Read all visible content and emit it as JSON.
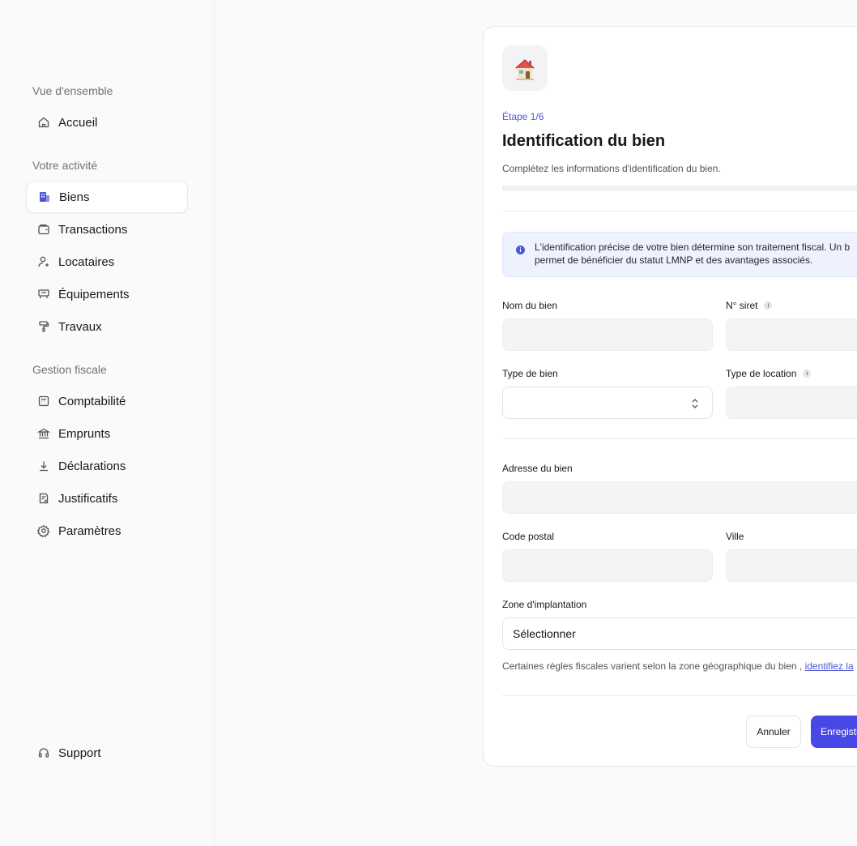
{
  "sidebar": {
    "sections": [
      {
        "title": "Vue d'ensemble",
        "items": [
          {
            "label": "Accueil",
            "icon": "home-icon"
          }
        ]
      },
      {
        "title": "Votre activité",
        "items": [
          {
            "label": "Biens",
            "icon": "building-icon",
            "active": true
          },
          {
            "label": "Transactions",
            "icon": "wallet-icon"
          },
          {
            "label": "Locataires",
            "icon": "user-plus-icon"
          },
          {
            "label": "Équipements",
            "icon": "sofa-icon"
          },
          {
            "label": "Travaux",
            "icon": "paint-roller-icon"
          }
        ]
      },
      {
        "title": "Gestion fiscale",
        "items": [
          {
            "label": "Comptabilité",
            "icon": "calculator-icon"
          },
          {
            "label": "Emprunts",
            "icon": "bank-icon"
          },
          {
            "label": "Déclarations",
            "icon": "download-icon"
          },
          {
            "label": "Justificatifs",
            "icon": "receipt-icon"
          },
          {
            "label": "Paramètres",
            "icon": "gear-icon"
          }
        ]
      }
    ],
    "support": {
      "label": "Support",
      "icon": "headset-icon"
    }
  },
  "form": {
    "step": "Étape 1/6",
    "title": "Identification du bien",
    "subtitle": "Complétez les informations d'identification du bien.",
    "info_line1": "L'identification précise de votre bien détermine son traitement fiscal. Un b",
    "info_line2": "permet de bénéficier du statut LMNP et des avantages associés.",
    "fields": {
      "nom_label": "Nom du bien",
      "siret_label": "N° siret",
      "type_bien_label": "Type de bien",
      "type_location_label": "Type de location",
      "adresse_label": "Adresse du bien",
      "code_postal_label": "Code postal",
      "ville_label": "Ville",
      "zone_label": "Zone d'implantation",
      "zone_value": "Sélectionner"
    },
    "helper_text": "Certaines règles fiscales varient selon la zone géographique du bien ,",
    "helper_link": "identifiez la",
    "cancel_label": "Annuler",
    "save_label": "Enregistrer"
  },
  "colors": {
    "accent": "#4848e6",
    "info_bg": "#eef2ff"
  }
}
